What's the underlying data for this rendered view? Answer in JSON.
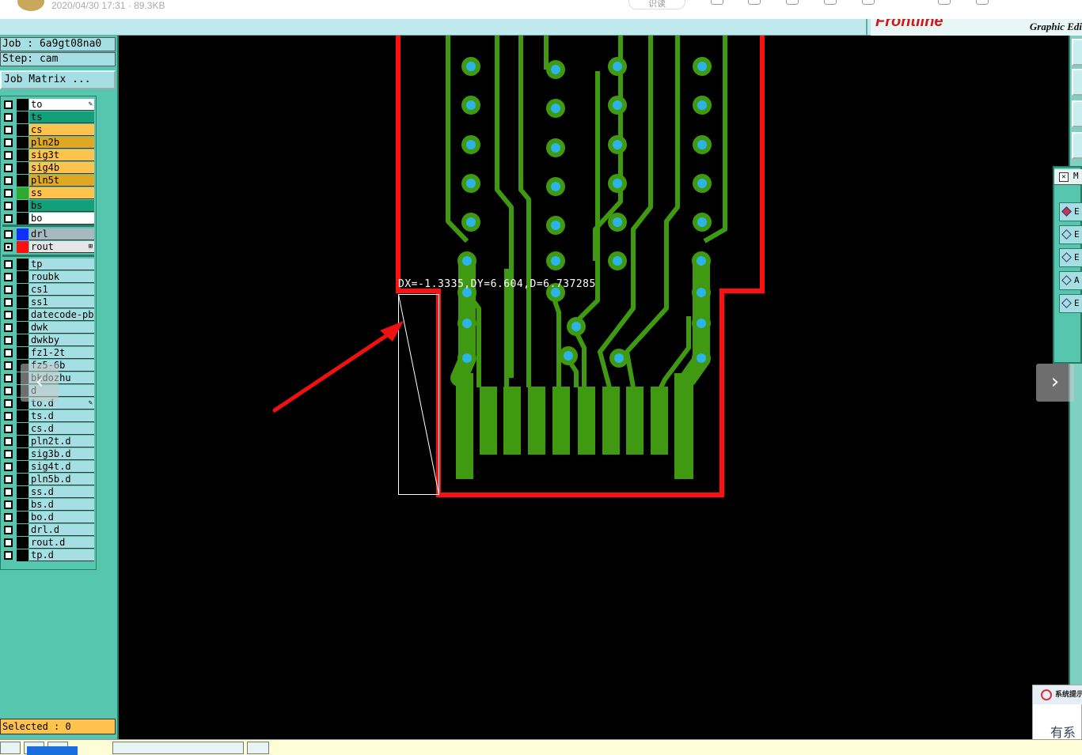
{
  "viewer": {
    "meta": "2020/04/30 17:31 · 89.3KB",
    "pill_label": "识读"
  },
  "titlebar": {
    "brand_text": "Frontline",
    "module": "Graphic Edi"
  },
  "job": {
    "job_line": "Job : 6a9gt08na0",
    "step_line": "Step: cam",
    "matrix_button": "Job Matrix ..."
  },
  "layer_groups": [
    [
      {
        "name": "to",
        "bg": "#ffffff",
        "swatch": "#000000",
        "checked": false,
        "mark": "✎"
      },
      {
        "name": "ts",
        "bg": "#12a07a",
        "swatch": "#000000",
        "checked": false,
        "mark": ""
      },
      {
        "name": "cs",
        "bg": "#ffc24d",
        "swatch": "#000000",
        "checked": false,
        "mark": ""
      },
      {
        "name": "pln2b",
        "bg": "#e0a820",
        "swatch": "#000000",
        "checked": false,
        "mark": ""
      },
      {
        "name": "sig3t",
        "bg": "#ffc24d",
        "swatch": "#000000",
        "checked": false,
        "mark": ""
      },
      {
        "name": "sig4b",
        "bg": "#ffc24d",
        "swatch": "#000000",
        "checked": false,
        "mark": ""
      },
      {
        "name": "pln5t",
        "bg": "#e0a820",
        "swatch": "#000000",
        "checked": false,
        "mark": ""
      },
      {
        "name": "ss",
        "bg": "#ffc24d",
        "swatch": "#2eaa2e",
        "checked": false,
        "mark": ""
      },
      {
        "name": "bs",
        "bg": "#12a07a",
        "swatch": "#000000",
        "checked": false,
        "mark": ""
      },
      {
        "name": "bo",
        "bg": "#ffffff",
        "swatch": "#000000",
        "checked": false,
        "mark": ""
      }
    ],
    [
      {
        "name": "drl",
        "bg": "#a8b8c0",
        "swatch": "#1030ff",
        "checked": false,
        "mark": ""
      },
      {
        "name": "rout",
        "bg": "#e6e6e6",
        "swatch": "#ff1010",
        "checked": true,
        "mark": "⊞"
      }
    ],
    [
      {
        "name": "tp",
        "bg": "#a6dfe3",
        "swatch": "#000000",
        "checked": false,
        "mark": ""
      },
      {
        "name": "roubk",
        "bg": "#a6dfe3",
        "swatch": "#000000",
        "checked": false,
        "mark": ""
      },
      {
        "name": "cs1",
        "bg": "#a6dfe3",
        "swatch": "#000000",
        "checked": false,
        "mark": ""
      },
      {
        "name": "ss1",
        "bg": "#a6dfe3",
        "swatch": "#000000",
        "checked": false,
        "mark": ""
      },
      {
        "name": "datecode-pbc",
        "bg": "#a6dfe3",
        "swatch": "#000000",
        "checked": false,
        "mark": ""
      },
      {
        "name": "dwk",
        "bg": "#a6dfe3",
        "swatch": "#000000",
        "checked": false,
        "mark": ""
      },
      {
        "name": "dwkby",
        "bg": "#a6dfe3",
        "swatch": "#000000",
        "checked": false,
        "mark": ""
      },
      {
        "name": "fz1-2t",
        "bg": "#a6dfe3",
        "swatch": "#000000",
        "checked": false,
        "mark": ""
      },
      {
        "name": "fz5-6b",
        "bg": "#a6dfe3",
        "swatch": "#000000",
        "checked": false,
        "mark": ""
      },
      {
        "name": "bkdozhu",
        "bg": "#a6dfe3",
        "swatch": "#000000",
        "checked": false,
        "mark": ""
      },
      {
        "name": "d",
        "bg": "#a6dfe3",
        "swatch": "#000000",
        "checked": false,
        "mark": ""
      },
      {
        "name": "to.d",
        "bg": "#a6dfe3",
        "swatch": "#000000",
        "checked": false,
        "mark": "✎"
      },
      {
        "name": "ts.d",
        "bg": "#a6dfe3",
        "swatch": "#000000",
        "checked": false,
        "mark": ""
      },
      {
        "name": "cs.d",
        "bg": "#a6dfe3",
        "swatch": "#000000",
        "checked": false,
        "mark": ""
      },
      {
        "name": "pln2t.d",
        "bg": "#a6dfe3",
        "swatch": "#000000",
        "checked": false,
        "mark": ""
      },
      {
        "name": "sig3b.d",
        "bg": "#a6dfe3",
        "swatch": "#000000",
        "checked": false,
        "mark": ""
      },
      {
        "name": "sig4t.d",
        "bg": "#a6dfe3",
        "swatch": "#000000",
        "checked": false,
        "mark": ""
      },
      {
        "name": "pln5b.d",
        "bg": "#a6dfe3",
        "swatch": "#000000",
        "checked": false,
        "mark": ""
      },
      {
        "name": "ss.d",
        "bg": "#a6dfe3",
        "swatch": "#000000",
        "checked": false,
        "mark": ""
      },
      {
        "name": "bs.d",
        "bg": "#a6dfe3",
        "swatch": "#000000",
        "checked": false,
        "mark": ""
      },
      {
        "name": "bo.d",
        "bg": "#a6dfe3",
        "swatch": "#000000",
        "checked": false,
        "mark": ""
      },
      {
        "name": "drl.d",
        "bg": "#a6dfe3",
        "swatch": "#000000",
        "checked": false,
        "mark": ""
      },
      {
        "name": "rout.d",
        "bg": "#a6dfe3",
        "swatch": "#000000",
        "checked": false,
        "mark": ""
      },
      {
        "name": "tp.d",
        "bg": "#a6dfe3",
        "swatch": "#000000",
        "checked": false,
        "mark": ""
      }
    ]
  ],
  "status": {
    "selected": "Selected : 0"
  },
  "measure": {
    "readout": "DX=-1.3335,DY=6.604,D=6.737285"
  },
  "colors": {
    "rout_outline": "#ff1010",
    "copper": "#3f9a12",
    "drill": "#2cb4e6",
    "panel": "#56c7ae",
    "annotation_arrow": "#ee1111"
  },
  "right_popup": {
    "title": "M",
    "items": [
      "E",
      "E",
      "E",
      "A",
      "E"
    ]
  },
  "system_popup": {
    "title": "系统提示",
    "body": "有系"
  },
  "nav": {
    "prev_icon": "chevron-left-icon",
    "next_icon": "chevron-right-icon"
  }
}
